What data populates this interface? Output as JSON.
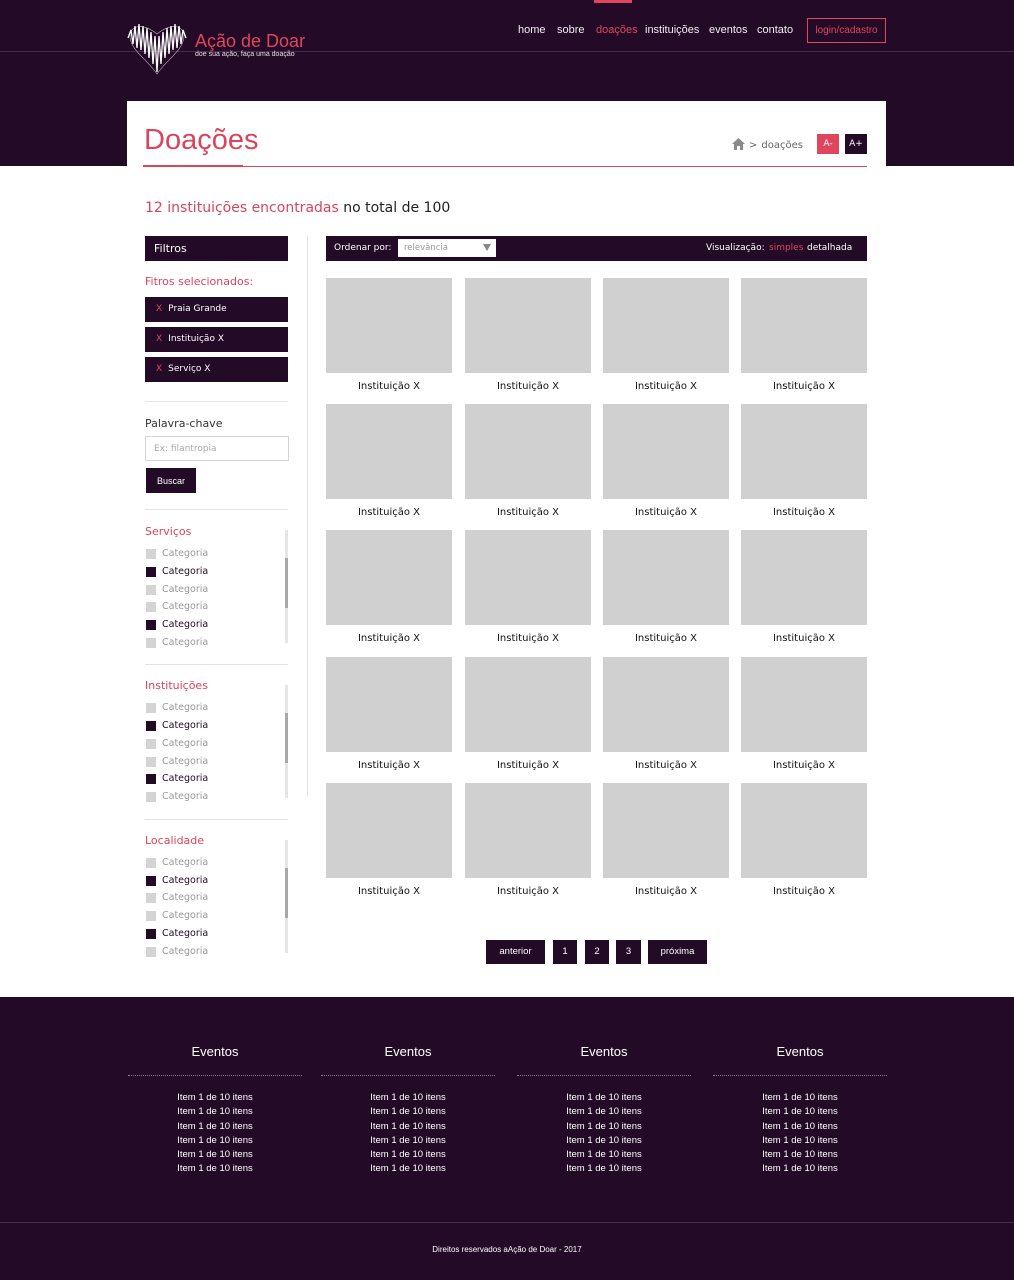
{
  "colors": {
    "primary": "#230a27",
    "accent": "#d8455c",
    "placeholder_tile": "#d0d0d0"
  },
  "brand": {
    "name": "Ação de Doar",
    "tagline": "doe sua ação, faça uma doação",
    "logo_icon": "heart-logo-icon"
  },
  "nav": {
    "items": [
      {
        "label": "home"
      },
      {
        "label": "sobre"
      },
      {
        "label": "doações",
        "active": true
      },
      {
        "label": "instituições"
      },
      {
        "label": "eventos"
      },
      {
        "label": "contato"
      }
    ],
    "login_label": "login/cadastro"
  },
  "page": {
    "title": "Doações",
    "breadcrumb_current": "doações",
    "breadcrumb_separator": ">",
    "home_icon": "home-icon",
    "font_decrease": "A-",
    "font_increase": "A+"
  },
  "results": {
    "highlight": "12 instituições encontradas",
    "rest": "no total de 100"
  },
  "sidebar": {
    "filters_title": "Filtros",
    "selected_title": "Fitros selecionados:",
    "remove_symbol": "X",
    "selected": [
      "Praia Grande",
      "Instituição X",
      "Serviço X"
    ],
    "keyword_label": "Palavra-chave",
    "keyword_placeholder": "Ex: filantropia",
    "search_label": "Buscar",
    "groups": [
      {
        "title": "Serviços",
        "items": [
          {
            "label": "Categoria",
            "checked": false
          },
          {
            "label": "Categoria",
            "checked": true
          },
          {
            "label": "Categoria",
            "checked": false
          },
          {
            "label": "Categoria",
            "checked": false
          },
          {
            "label": "Categoria",
            "checked": true
          },
          {
            "label": "Categoria",
            "checked": false
          }
        ]
      },
      {
        "title": "Instituições",
        "items": [
          {
            "label": "Categoria",
            "checked": false
          },
          {
            "label": "Categoria",
            "checked": true
          },
          {
            "label": "Categoria",
            "checked": false
          },
          {
            "label": "Categoria",
            "checked": false
          },
          {
            "label": "Categoria",
            "checked": true
          },
          {
            "label": "Categoria",
            "checked": false
          }
        ]
      },
      {
        "title": "Localidade",
        "items": [
          {
            "label": "Categoria",
            "checked": false
          },
          {
            "label": "Categoria",
            "checked": true
          },
          {
            "label": "Categoria",
            "checked": false
          },
          {
            "label": "Categoria",
            "checked": false
          },
          {
            "label": "Categoria",
            "checked": true
          },
          {
            "label": "Categoria",
            "checked": false
          }
        ]
      }
    ]
  },
  "toolbar": {
    "order_label": "Ordenar por:",
    "order_value": "relevância",
    "view_label": "Visualização:",
    "view_simple": "simples",
    "view_detailed": "detalhada",
    "view_selected": "simples"
  },
  "grid": {
    "items": [
      "Instituição X",
      "Instituição X",
      "Instituição X",
      "Instituição X",
      "Instituição X",
      "Instituição X",
      "Instituição X",
      "Instituição X",
      "Instituição X",
      "Instituição X",
      "Instituição X",
      "Instituição X",
      "Instituição X",
      "Instituição X",
      "Instituição X",
      "Instituição X",
      "Instituição X",
      "Instituição X",
      "Instituição X",
      "Instituição X"
    ]
  },
  "pagination": {
    "prev": "anterior",
    "pages": [
      "1",
      "2",
      "3"
    ],
    "next": "próxima"
  },
  "footer": {
    "columns": [
      {
        "title": "Eventos",
        "items": [
          "Item 1 de 10 itens",
          "Item 1 de 10 itens",
          "Item 1 de 10 itens",
          "Item 1 de 10 itens",
          "Item 1 de 10 itens",
          "Item 1 de 10 itens"
        ]
      },
      {
        "title": "Eventos",
        "items": [
          "Item 1 de 10 itens",
          "Item 1 de 10 itens",
          "Item 1 de 10 itens",
          "Item 1 de 10 itens",
          "Item 1 de 10 itens",
          "Item 1 de 10 itens"
        ]
      },
      {
        "title": "Eventos",
        "items": [
          "Item 1 de 10 itens",
          "Item 1 de 10 itens",
          "Item 1 de 10 itens",
          "Item 1 de 10 itens",
          "Item 1 de 10 itens",
          "Item 1 de 10 itens"
        ]
      },
      {
        "title": "Eventos",
        "items": [
          "Item 1 de 10 itens",
          "Item 1 de 10 itens",
          "Item 1 de 10 itens",
          "Item 1 de 10 itens",
          "Item 1 de 10 itens",
          "Item 1 de 10 itens"
        ]
      }
    ],
    "copyright": "Direitos reservados aAção de Doar - 2017"
  }
}
